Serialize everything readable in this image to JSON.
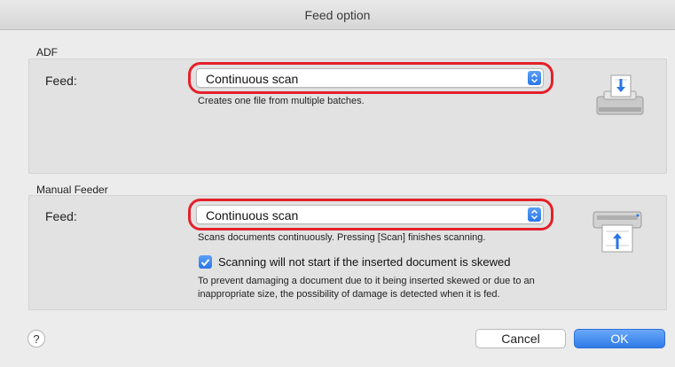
{
  "window": {
    "title": "Feed option"
  },
  "adf": {
    "section_label": "ADF",
    "feed_label": "Feed:",
    "feed_value": "Continuous scan",
    "description": "Creates one file from multiple batches."
  },
  "manual": {
    "section_label": "Manual Feeder",
    "feed_label": "Feed:",
    "feed_value": "Continuous scan",
    "description": "Scans documents continuously. Pressing [Scan] finishes scanning.",
    "checkbox": {
      "label": "Scanning will not start if the inserted document is skewed",
      "checked": true
    },
    "note_line1": "To prevent damaging a document due to it being inserted skewed or due to an",
    "note_line2": "inappropriate size, the possibility of damage is detected when it is fed."
  },
  "footer": {
    "help": "?",
    "cancel": "Cancel",
    "ok": "OK"
  },
  "colors": {
    "accent": "#2f7be8",
    "highlight_ring": "#e5202a"
  },
  "icons": [
    "chevron-updown-icon",
    "adf-scanner-icon",
    "manual-feeder-scanner-icon",
    "checkmark-icon"
  ]
}
